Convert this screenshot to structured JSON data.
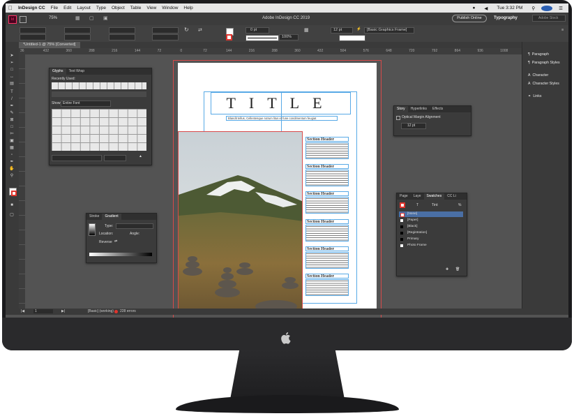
{
  "menubar": {
    "app_name": "InDesign CC",
    "items": [
      "File",
      "Edit",
      "Layout",
      "Type",
      "Object",
      "Table",
      "View",
      "Window",
      "Help"
    ],
    "clock": "Tue 3:32 PM"
  },
  "appbar": {
    "zoom": "75%",
    "window_title": "Adobe InDesign CC 2019",
    "publish_label": "Publish Online",
    "workspace": "Typography",
    "search_placeholder": "Adobe Stock"
  },
  "control_panel": {
    "stroke_weight": "0 pt",
    "opacity": "100%",
    "frame_weight": "12 pt",
    "object_style": "[Basic Graphics Frame]"
  },
  "document_tab": {
    "label": "*Untitled-1 @ 75% [Converted]"
  },
  "ruler": {
    "ticks": [
      "36",
      "432",
      "360",
      "288",
      "216",
      "144",
      "72",
      "0",
      "72",
      "144",
      "216",
      "288",
      "360",
      "432",
      "504",
      "576",
      "648",
      "720",
      "792",
      "864",
      "936",
      "1008"
    ]
  },
  "right_panel": {
    "items": [
      {
        "icon": "paragraph-icon",
        "label": "Paragraph"
      },
      {
        "icon": "paragraph-styles-icon",
        "label": "Paragraph Styles"
      },
      {
        "icon": "character-icon",
        "label": "Character"
      },
      {
        "icon": "character-styles-icon",
        "label": "Character Styles"
      },
      {
        "icon": "links-icon",
        "label": "Links"
      }
    ]
  },
  "glyphs_panel": {
    "tabs": [
      "Glyphs",
      "Text Wrap"
    ],
    "recently_used_label": "Recently Used:",
    "show_label": "Show:",
    "show_value": "Entire Font"
  },
  "gradient_panel": {
    "tabs": [
      "Stroke",
      "Gradient"
    ],
    "type_label": "Type:",
    "location_label": "Location:",
    "angle_label": "Angle:",
    "reverse_label": "Reverse"
  },
  "story_panel": {
    "tabs": [
      "Story",
      "Hyperlinks",
      "Effects"
    ],
    "option_label": "Optical Margin Alignment",
    "size_value": "12 pt"
  },
  "swatches_panel": {
    "tabs": [
      "Page",
      "Laye",
      "Swatches",
      "CC Li"
    ],
    "tint_label": "Tint:",
    "tint_unit": "%",
    "swatches": [
      {
        "name": "[None]",
        "color": "#ffffff"
      },
      {
        "name": "[Paper]",
        "color": "#ffffff"
      },
      {
        "name": "[Black]",
        "color": "#000000"
      },
      {
        "name": "[Registration]",
        "color": "#000000"
      },
      {
        "name": "Primary",
        "color": "#000000"
      },
      {
        "name": "Photo Frame",
        "color": "#ffffff"
      }
    ]
  },
  "document": {
    "title": "TITLE",
    "byline": "Blandit tellus, Cellentesque rutrum litus et fune condimentum feugiat",
    "section_header": "Section Header"
  },
  "statusbar": {
    "page": "1",
    "preflight_profile": "[Basic] (working)",
    "errors": "228 errors"
  },
  "colors": {
    "accent_guide": "#57a9e6",
    "bleed": "#d84a4a",
    "error": "#e0342d"
  }
}
